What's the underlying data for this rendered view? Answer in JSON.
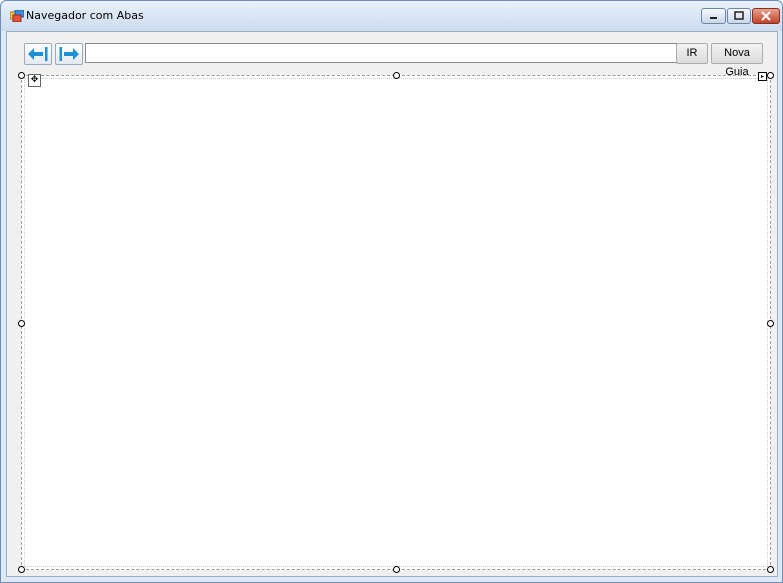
{
  "window": {
    "title": "Navegador com Abas"
  },
  "toolbar": {
    "back_icon": "arrow-left-icon",
    "forward_icon": "arrow-right-icon",
    "url_value": "",
    "go_label": "IR",
    "new_tab_label": "Nova Guia"
  },
  "colors": {
    "accent": "#1e90d6",
    "titlebar": "#dce8f6",
    "close": "#c0432b"
  }
}
